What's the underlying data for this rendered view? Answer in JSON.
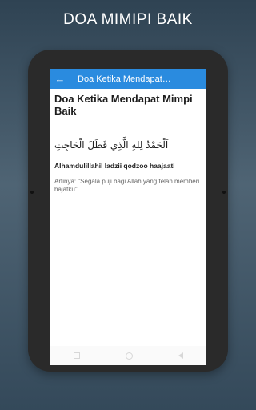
{
  "promo": {
    "title": "DOA MIMIPI BAIK"
  },
  "app_bar": {
    "title": "Doa Ketika Mendapat…",
    "back_icon": "arrow-left-icon",
    "color": "#2a8bdf"
  },
  "content": {
    "heading": "Doa Ketika Mendapat Mimpi Baik",
    "arabic": "اَلْحَمْدُ لِلهِ الَّذِي قَطَلَ الْحَاجِتِ",
    "latin": "Alhamdulillahil ladzii qodzoo haajaati",
    "meaning": "Artinya: \"Segala puji bagi Allah yang telah memberi hajatku\""
  },
  "nav_bar": {
    "recent_icon": "square-icon",
    "home_icon": "circle-icon",
    "back_icon": "triangle-back-icon"
  }
}
